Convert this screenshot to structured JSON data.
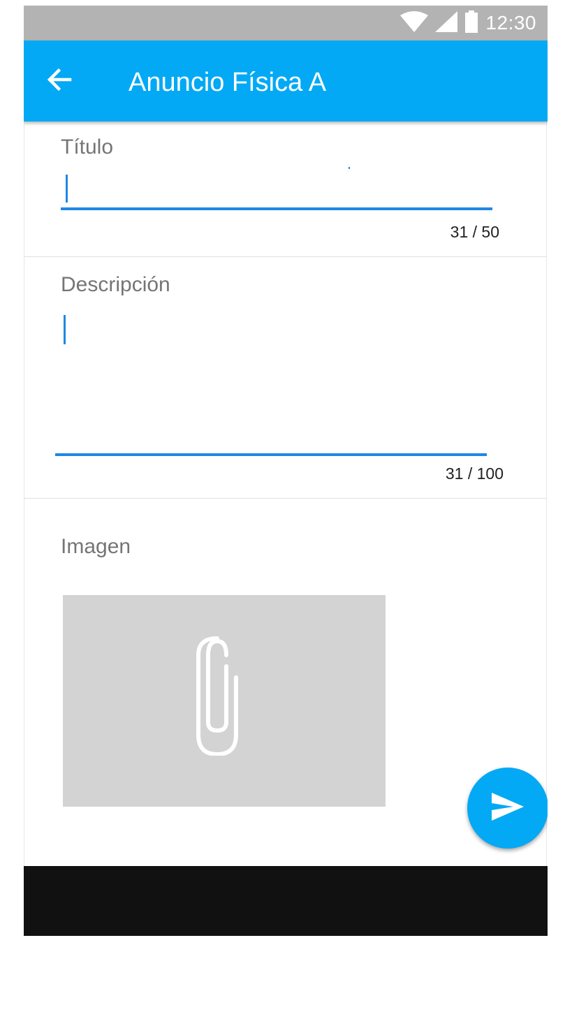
{
  "status_bar": {
    "time": "12:30",
    "icons": [
      "wifi-icon",
      "signal-icon",
      "battery-icon"
    ],
    "background": "#b3b3b3"
  },
  "app_bar": {
    "title": "Anuncio Física A",
    "back_icon": "arrow-back-icon",
    "background": "#03a9f4"
  },
  "form": {
    "title_field": {
      "label": "Título",
      "value": "",
      "counter": "31 / 50"
    },
    "description_field": {
      "label": "Descripción",
      "value": "",
      "counter": "31 / 100"
    },
    "image_field": {
      "label": "Imagen",
      "icon": "paperclip-icon"
    }
  },
  "fab": {
    "icon": "send-icon"
  },
  "colors": {
    "accent": "#03a9f4",
    "input_line": "#1e88e5",
    "label": "#757575",
    "placeholder_bg": "#d3d3d3"
  }
}
